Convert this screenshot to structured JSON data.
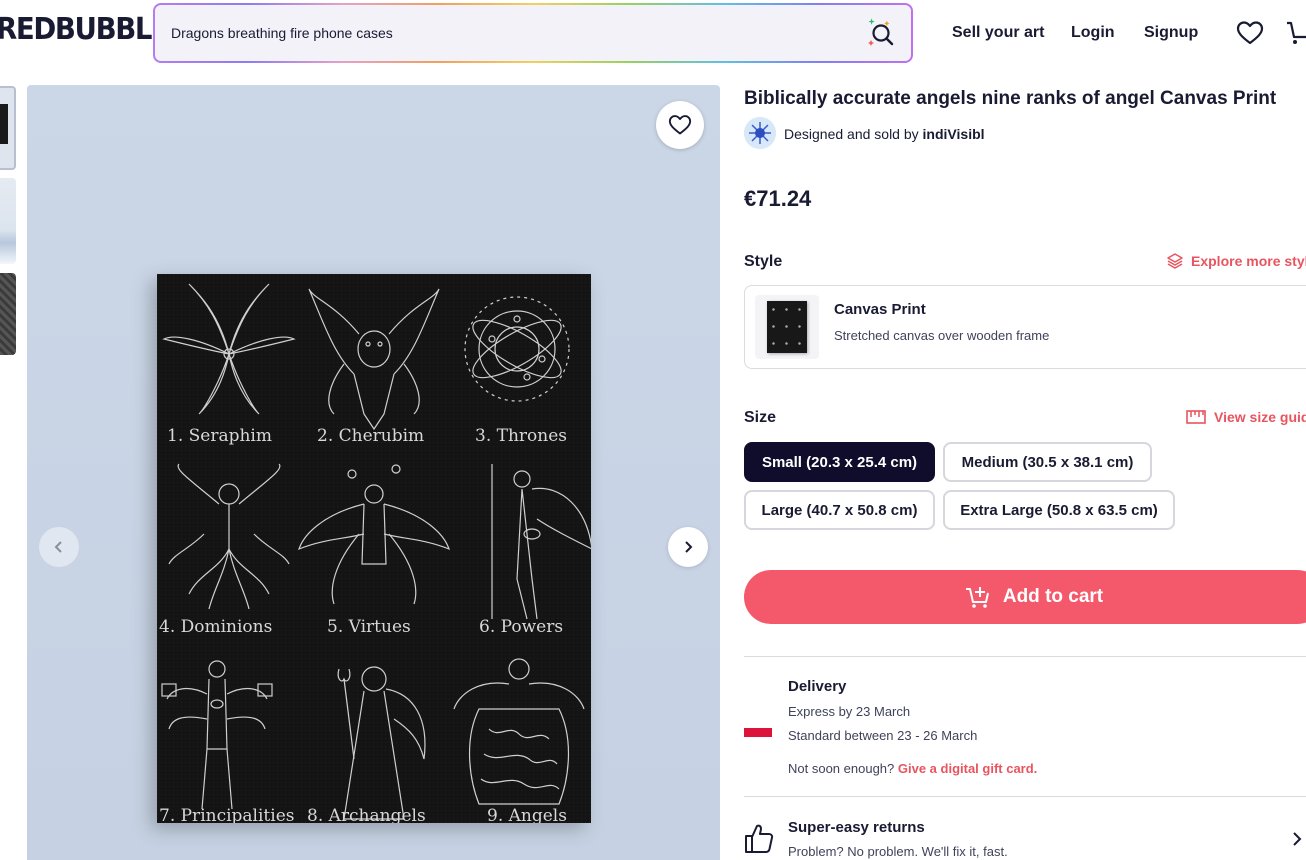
{
  "header": {
    "logo": "REDBUBBLE",
    "search": {
      "value": "Dragons breathing fire phone cases"
    },
    "nav": {
      "sell": "Sell your art",
      "login": "Login",
      "signup": "Signup"
    }
  },
  "gallery": {
    "ranks": [
      "1. Seraphim",
      "2. Cherubim",
      "3. Thrones",
      "4. Dominions",
      "5. Virtues",
      "6. Powers",
      "7. Principalities",
      "8. Archangels",
      "9. Angels"
    ]
  },
  "product": {
    "title": "Biblically accurate angels nine ranks of angel Canvas Print",
    "designer_prefix": "Designed and sold by ",
    "designer_name": "indiVisibl",
    "price": "€71.24",
    "style": {
      "label": "Style",
      "explore_link": "Explore more styles",
      "selected_name": "Canvas Print",
      "selected_desc": "Stretched canvas over wooden frame"
    },
    "size": {
      "label": "Size",
      "guide_link": "View size guide",
      "options": [
        "Small (20.3 x 25.4 cm)",
        "Medium (30.5 x 38.1 cm)",
        "Large (40.7 x 50.8 cm)",
        "Extra Large (50.8 x 63.5 cm)"
      ],
      "selected": "Small (20.3 x 25.4 cm)"
    },
    "add_to_cart": "Add to cart"
  },
  "delivery": {
    "title": "Delivery",
    "express": "Express by 23 March",
    "standard": "Standard between 23 - 26 March",
    "note_prefix": "Not soon enough? ",
    "note_link": "Give a digital gift card."
  },
  "returns": {
    "title": "Super-easy returns",
    "subtitle": "Problem? No problem. We'll fix it, fast."
  },
  "colors": {
    "accent": "#f3596a",
    "accent_text": "#e8545f",
    "navy": "#0f0c2c",
    "text": "#191b33"
  }
}
